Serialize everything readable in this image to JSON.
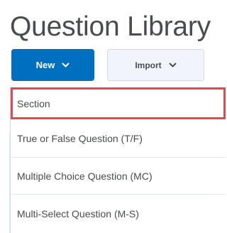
{
  "page": {
    "title": "Question Library"
  },
  "toolbar": {
    "new_label": "New",
    "new_icon": "chevron-down-icon",
    "import_label": "Import",
    "import_icon": "chevron-down-icon",
    "new_button_color": "#006fbf"
  },
  "new_menu": {
    "highlight_color": "#e8474b",
    "items": [
      {
        "label": "Section",
        "highlighted": true
      },
      {
        "label": "True or False Question (T/F)",
        "highlighted": false
      },
      {
        "label": "Multiple Choice Question (MC)",
        "highlighted": false
      },
      {
        "label": "Multi-Select Question (M-S)",
        "highlighted": false
      }
    ]
  }
}
